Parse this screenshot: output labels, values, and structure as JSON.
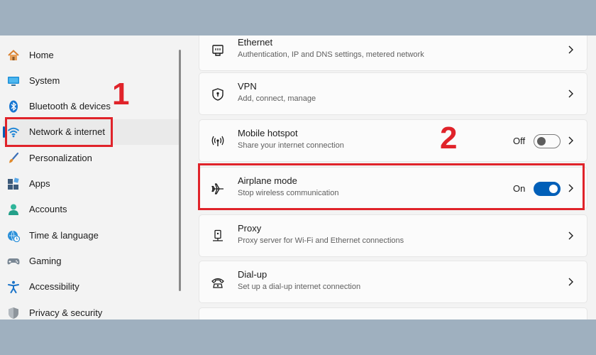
{
  "sidebar": {
    "items": [
      {
        "label": "Home",
        "icon": "home-icon"
      },
      {
        "label": "System",
        "icon": "system-icon"
      },
      {
        "label": "Bluetooth & devices",
        "icon": "bluetooth-icon"
      },
      {
        "label": "Network & internet",
        "icon": "wifi-icon",
        "active": true
      },
      {
        "label": "Personalization",
        "icon": "brush-icon"
      },
      {
        "label": "Apps",
        "icon": "apps-icon"
      },
      {
        "label": "Accounts",
        "icon": "accounts-icon"
      },
      {
        "label": "Time & language",
        "icon": "time-language-icon"
      },
      {
        "label": "Gaming",
        "icon": "gaming-icon"
      },
      {
        "label": "Accessibility",
        "icon": "accessibility-icon"
      },
      {
        "label": "Privacy & security",
        "icon": "shield-icon"
      }
    ]
  },
  "cards": [
    {
      "title": "Ethernet",
      "desc": "Authentication, IP and DNS settings, metered network",
      "icon": "ethernet-icon"
    },
    {
      "title": "VPN",
      "desc": "Add, connect, manage",
      "icon": "vpn-shield-icon"
    },
    {
      "title": "Mobile hotspot",
      "desc": "Share your internet connection",
      "icon": "hotspot-icon",
      "toggle": {
        "state": "Off",
        "on": false
      }
    },
    {
      "title": "Airplane mode",
      "desc": "Stop wireless communication",
      "icon": "airplane-icon",
      "toggle": {
        "state": "On",
        "on": true
      }
    },
    {
      "title": "Proxy",
      "desc": "Proxy server for Wi-Fi and Ethernet connections",
      "icon": "proxy-icon"
    },
    {
      "title": "Dial-up",
      "desc": "Set up a dial-up internet connection",
      "icon": "dialup-icon"
    }
  ],
  "annotations": {
    "step1": "1",
    "step2": "2"
  },
  "colors": {
    "accent": "#005fb8",
    "annotation": "#e0232a",
    "background": "#9fb0bf"
  }
}
